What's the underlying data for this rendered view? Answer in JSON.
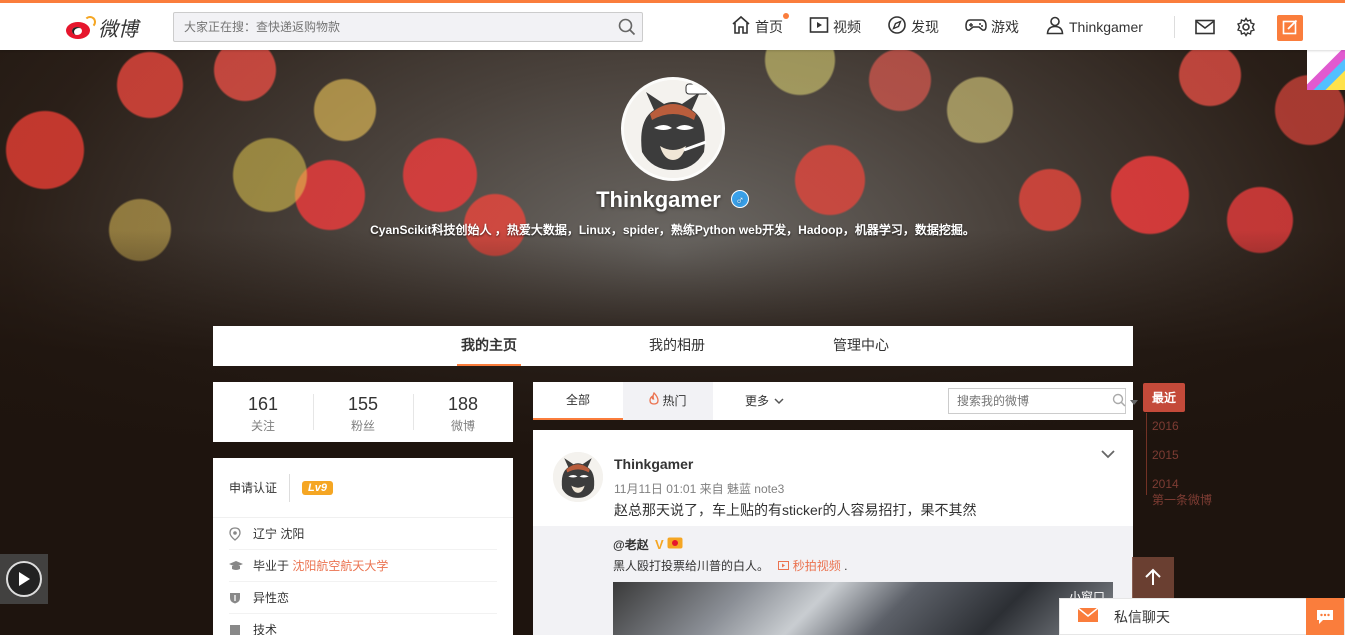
{
  "colors": {
    "brand": "#fa7d3c",
    "link": "#eb7350",
    "timeline_active": "#c44a3a",
    "gender": "#3aa0e8"
  },
  "header": {
    "logo_text": "微博",
    "search": {
      "placeholder": "大家正在搜：查快递返购物款"
    },
    "nav": [
      {
        "label": "首页",
        "icon": "home-icon"
      },
      {
        "label": "视频",
        "icon": "video-icon"
      },
      {
        "label": "发现",
        "icon": "compass-icon"
      },
      {
        "label": "游戏",
        "icon": "gamepad-icon"
      },
      {
        "label": "Thinkgamer",
        "icon": "user-icon"
      }
    ]
  },
  "profile": {
    "name": "Thinkgamer",
    "gender_icon": "♂",
    "bio": "CyanScikit科技创始人 ，热爱大数据，Linux，spider，熟练Python web开发，Hadoop，机器学习，数据挖掘。"
  },
  "tabs": [
    {
      "label": "我的主页",
      "active": true
    },
    {
      "label": "我的相册",
      "active": false
    },
    {
      "label": "管理中心",
      "active": false
    }
  ],
  "stats": [
    {
      "num": "161",
      "label": "关注"
    },
    {
      "num": "155",
      "label": "粉丝"
    },
    {
      "num": "188",
      "label": "微博"
    }
  ],
  "info": {
    "cert_label": "申请认证",
    "level": "Lv9",
    "location": "辽宁 沈阳",
    "edu_prefix": "毕业于",
    "school": "沈阳航空航天大学",
    "orientation": "异性恋",
    "next_row": "技术"
  },
  "feed_tabs": {
    "all": "全部",
    "hot": "热门",
    "more": "更多"
  },
  "feed_search": {
    "placeholder": "搜索我的微博"
  },
  "post": {
    "author": "Thinkgamer",
    "meta": "11月11日 01:01 来自 魅蓝 note3",
    "text": "赵总那天说了，车上贴的有sticker的人容易招打，果不其然",
    "repost": {
      "author": "@老赵",
      "text": "黑人殴打投票给川普的白人。",
      "video_link": "秒拍视频",
      "video_suffix": ".",
      "video_label": "小窗口"
    }
  },
  "timeline": {
    "active": "最近",
    "years": [
      "2016",
      "2015",
      "2014"
    ],
    "first": "第一条微博"
  },
  "chat": {
    "label": "私信聊天"
  }
}
